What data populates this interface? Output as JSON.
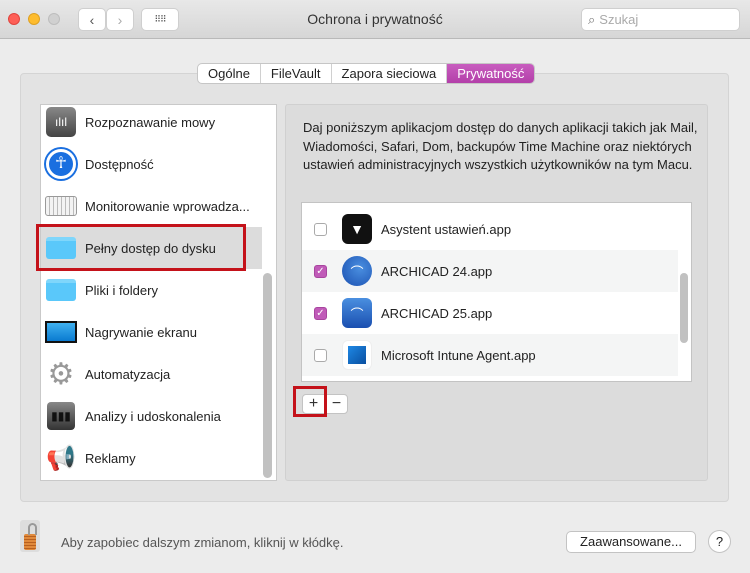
{
  "window": {
    "title": "Ochrona i prywatność",
    "search_placeholder": "Szukaj"
  },
  "tabs": [
    {
      "label": "Ogólne"
    },
    {
      "label": "FileVault"
    },
    {
      "label": "Zapora sieciowa"
    },
    {
      "label": "Prywatność",
      "active": true
    }
  ],
  "sidebar": {
    "items": [
      {
        "label": "Rozpoznawanie mowy",
        "icon": "waveform-icon"
      },
      {
        "label": "Dostępność",
        "icon": "accessibility-icon"
      },
      {
        "label": "Monitorowanie wprowadza...",
        "icon": "keyboard-icon"
      },
      {
        "label": "Pełny dostęp do dysku",
        "icon": "folder-icon",
        "selected": true
      },
      {
        "label": "Pliki i foldery",
        "icon": "folder-icon"
      },
      {
        "label": "Nagrywanie ekranu",
        "icon": "display-icon"
      },
      {
        "label": "Automatyzacja",
        "icon": "gear-icon"
      },
      {
        "label": "Analizy i udoskonalenia",
        "icon": "chart-icon"
      },
      {
        "label": "Reklamy",
        "icon": "megaphone-icon"
      }
    ]
  },
  "main": {
    "description": "Daj poniższym aplikacjom dostęp do danych aplikacji takich jak Mail, Wiadomości, Safari, Dom, backupów Time Machine oraz niektórych ustawień administracyjnych wszystkich użytkowników na tym Macu.",
    "apps": [
      {
        "name": "Asystent ustawień.app",
        "checked": false
      },
      {
        "name": "ARCHICAD 24.app",
        "checked": true
      },
      {
        "name": "ARCHICAD 25.app",
        "checked": true
      },
      {
        "name": "Microsoft Intune Agent.app",
        "checked": false
      }
    ],
    "add_label": "+",
    "remove_label": "−"
  },
  "footer": {
    "lock_text": "Aby zapobiec dalszym zmianom, kliknij w kłódkę.",
    "advanced_label": "Zaawansowane...",
    "help_label": "?"
  },
  "colors": {
    "accent": "#b33fa9",
    "highlight": "#c4121a"
  }
}
